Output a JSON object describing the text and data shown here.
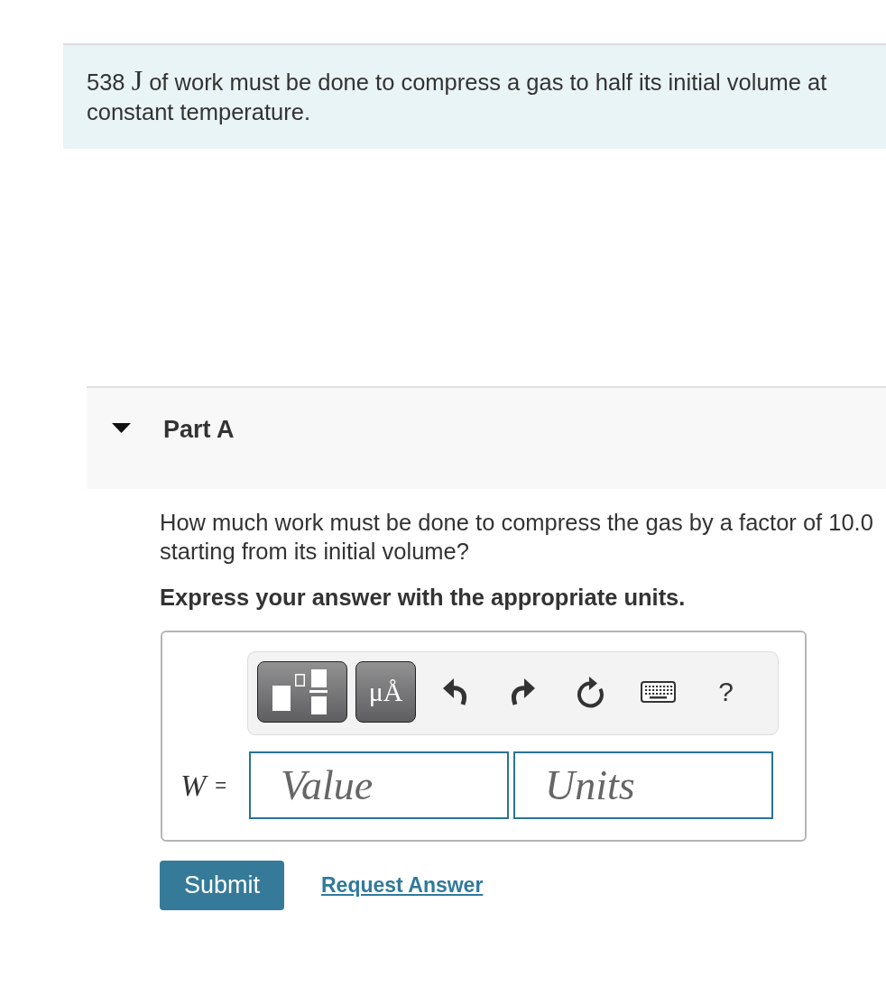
{
  "problem": {
    "quantity": "538",
    "unit": "J",
    "text": "of work must be done to compress a gas to half its initial volume at constant temperature."
  },
  "part": {
    "title": "Part A",
    "expanded": true,
    "question": "How much work must be done to compress the gas by a factor of 10.0 starting from its initial volume?",
    "instruction": "Express your answer with the appropriate units.",
    "toolbar": [
      {
        "kind": "templates"
      },
      {
        "kind": "symbols",
        "label": "μÅ"
      },
      {
        "kind": "undo"
      },
      {
        "kind": "redo"
      },
      {
        "kind": "reset"
      },
      {
        "kind": "keyboard"
      },
      {
        "kind": "help",
        "label": "?"
      }
    ],
    "answer": {
      "variable": "W",
      "sign": "=",
      "fields": [
        {
          "placeholder": "Value"
        },
        {
          "placeholder": "Units"
        }
      ]
    },
    "actions": [
      {
        "kind": "button",
        "label": "Submit"
      },
      {
        "kind": "link",
        "label": "Request Answer"
      }
    ]
  }
}
